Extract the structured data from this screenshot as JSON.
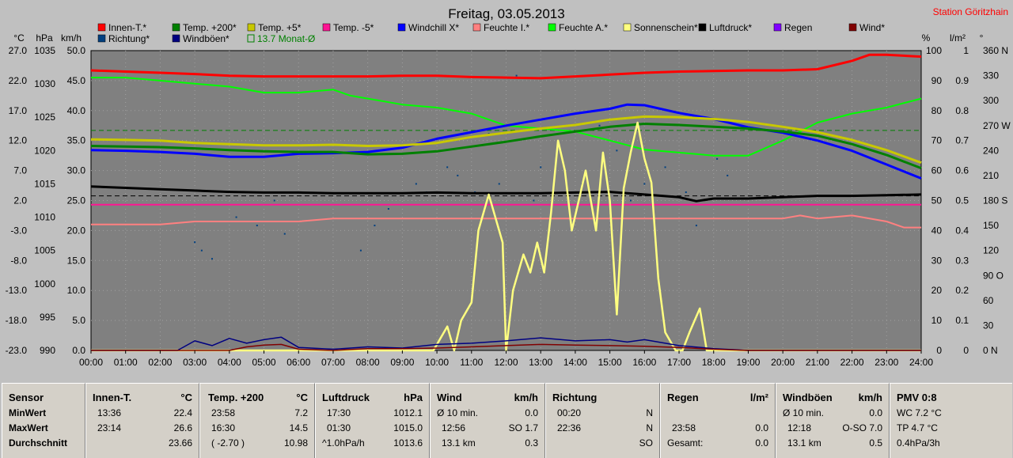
{
  "chart_data": {
    "type": "line",
    "title": "Freitag, 03.05.2013",
    "station": "Station Göritzhain",
    "x_ticks": [
      "00:00",
      "01:00",
      "02:00",
      "03:00",
      "04:00",
      "05:00",
      "06:00",
      "07:00",
      "08:00",
      "09:00",
      "10:00",
      "11:00",
      "12:00",
      "13:00",
      "14:00",
      "15:00",
      "16:00",
      "17:00",
      "18:00",
      "19:00",
      "20:00",
      "21:00",
      "22:00",
      "23:00",
      "24:00"
    ],
    "axis_units_left": [
      "°C",
      "hPa",
      "km/h"
    ],
    "axis_units_right": [
      "%",
      "l/m²",
      "°"
    ],
    "axis_temp": {
      "range": [
        -23,
        27
      ],
      "ticks": [
        "27.0",
        "22.0",
        "17.0",
        "12.0",
        "7.0",
        "2.0",
        "-3.0",
        "-8.0",
        "-13.0",
        "-18.0",
        "-23.0"
      ]
    },
    "axis_pressure": {
      "range": [
        990,
        1035
      ],
      "ticks": [
        "1035",
        "1030",
        "1025",
        "1020",
        "1015",
        "1010",
        "1005",
        "1000",
        "995",
        "990"
      ]
    },
    "axis_wind": {
      "range": [
        0,
        50
      ],
      "ticks": [
        "50.0",
        "45.0",
        "40.0",
        "35.0",
        "30.0",
        "25.0",
        "20.0",
        "15.0",
        "10.0",
        "5.0",
        "0.0"
      ]
    },
    "axis_humidity": {
      "range": [
        0,
        100
      ],
      "ticks": [
        "100",
        "90",
        "80",
        "70",
        "60",
        "50",
        "40",
        "30",
        "20",
        "10",
        "0"
      ]
    },
    "axis_rain": {
      "range": [
        0,
        1
      ],
      "ticks": [
        "1",
        "0.9",
        "0.8",
        "0.7",
        "0.6",
        "0.5",
        "0.4",
        "0.3",
        "0.2",
        "0.1",
        "0"
      ]
    },
    "axis_direction": {
      "range": [
        0,
        360
      ],
      "ticks": [
        "360 N",
        "330",
        "300",
        "270 W",
        "240",
        "210",
        "180 S",
        "150",
        "120",
        "90 O",
        "60",
        "30",
        "0 N"
      ]
    },
    "legend": [
      {
        "label": "Innen-T.*",
        "color": "#ff0000"
      },
      {
        "label": "Temp. +200*",
        "color": "#008000"
      },
      {
        "label": "Temp. +5*",
        "color": "#c8c800"
      },
      {
        "label": "Temp. -5*",
        "color": "#ff1493"
      },
      {
        "label": "Windchill X*",
        "color": "#0000ff"
      },
      {
        "label": "Feuchte I.*",
        "color": "#ff8080"
      },
      {
        "label": "Feuchte A.*",
        "color": "#00ff00"
      },
      {
        "label": "Sonnenschein*",
        "color": "#ffff80"
      },
      {
        "label": "Luftdruck*",
        "color": "#000000"
      },
      {
        "label": "Regen",
        "color": "#8000ff"
      },
      {
        "label": "Wind*",
        "color": "#800000"
      },
      {
        "label": "Richtung*",
        "color": "#004080"
      },
      {
        "label": "Windböen*",
        "color": "#000080"
      },
      {
        "label": "13.7 Monat-Ø",
        "color": "#008000"
      }
    ],
    "series": [
      {
        "name": "Innen-T.*",
        "axis": "temp",
        "color": "#ff0000",
        "width": 3,
        "x": [
          0,
          1,
          2,
          3,
          4,
          5,
          6,
          7,
          8,
          9,
          10,
          11,
          12,
          13,
          14,
          15,
          16,
          17,
          18,
          19,
          20,
          21,
          22,
          22.5,
          23,
          24
        ],
        "y": [
          23.7,
          23.5,
          23.3,
          23.1,
          22.8,
          22.7,
          22.7,
          22.7,
          22.7,
          22.8,
          22.8,
          22.6,
          22.5,
          22.4,
          22.7,
          23.0,
          23.3,
          23.5,
          23.6,
          23.7,
          23.7,
          23.9,
          25.3,
          26.3,
          26.3,
          26.0
        ]
      },
      {
        "name": "Feuchte A.*",
        "axis": "humidity",
        "color": "#00ff00",
        "width": 2,
        "x": [
          0,
          1,
          2,
          3,
          4,
          5,
          6,
          7,
          7.5,
          8,
          9,
          10,
          11,
          12,
          13,
          14,
          15,
          16,
          17,
          18,
          19,
          20,
          21,
          22,
          23,
          24
        ],
        "y": [
          91,
          91,
          90,
          89,
          88,
          86,
          86,
          87,
          85,
          84,
          82,
          81,
          79,
          75,
          74,
          73,
          70,
          67,
          66,
          65,
          65,
          70,
          76,
          79,
          81,
          84
        ]
      },
      {
        "name": "Windchill X*",
        "axis": "temp",
        "color": "#0000ff",
        "width": 3,
        "x": [
          0,
          1,
          2,
          3,
          4,
          5,
          6,
          7,
          8,
          9,
          10,
          11,
          12,
          13,
          14,
          15,
          15.5,
          16,
          17,
          18,
          19,
          20,
          21,
          22,
          23,
          24
        ],
        "y": [
          10.4,
          10.3,
          10.1,
          9.8,
          9.3,
          9.3,
          9.8,
          9.9,
          10.1,
          10.8,
          12.3,
          13.4,
          14.5,
          15.5,
          16.5,
          17.3,
          18.0,
          17.9,
          16.6,
          15.6,
          14.2,
          13.3,
          12.0,
          10.3,
          8.0,
          5.7
        ]
      },
      {
        "name": "Temp. +5*",
        "axis": "temp",
        "color": "#c8c800",
        "width": 3,
        "x": [
          0,
          1,
          2,
          3,
          4,
          5,
          6,
          7,
          8,
          9,
          10,
          11,
          12,
          13,
          14,
          15,
          16,
          17,
          18,
          19,
          20,
          21,
          22,
          23,
          24
        ],
        "y": [
          12.2,
          12.1,
          12.0,
          11.6,
          11.4,
          11.2,
          11.2,
          11.3,
          11.1,
          11.2,
          11.6,
          12.6,
          13.3,
          14.0,
          14.6,
          15.5,
          16.0,
          15.9,
          15.6,
          15.1,
          14.3,
          13.4,
          12.1,
          10.4,
          8.3
        ]
      },
      {
        "name": "Temp. +200*",
        "axis": "temp",
        "color": "#008000",
        "width": 3,
        "x": [
          0,
          1,
          2,
          3,
          4,
          5,
          6,
          7,
          8,
          9,
          10,
          11,
          12,
          13,
          14,
          15,
          16,
          17,
          18,
          19,
          20,
          21,
          22,
          23,
          24
        ],
        "y": [
          11.1,
          11.0,
          10.9,
          10.7,
          10.4,
          10.2,
          10.1,
          10.1,
          9.7,
          9.8,
          10.2,
          11.0,
          11.8,
          12.7,
          13.5,
          14.3,
          14.8,
          14.6,
          14.3,
          14.0,
          13.5,
          12.8,
          11.4,
          9.6,
          7.4
        ]
      },
      {
        "name": "Luftdruck*",
        "axis": "pressure",
        "color": "#000000",
        "width": 3,
        "x": [
          0,
          1,
          2,
          3,
          4,
          5,
          6,
          7,
          8,
          9,
          10,
          11,
          12,
          13,
          14,
          15,
          16,
          17,
          17.5,
          18,
          19,
          20,
          21,
          22,
          23,
          24
        ],
        "y": [
          1014.6,
          1014.4,
          1014.2,
          1014.0,
          1013.8,
          1013.7,
          1013.7,
          1013.6,
          1013.6,
          1013.6,
          1013.7,
          1013.6,
          1013.6,
          1013.6,
          1013.7,
          1013.8,
          1013.4,
          1013.0,
          1012.4,
          1012.8,
          1012.8,
          1013.0,
          1013.2,
          1013.2,
          1013.3,
          1013.4
        ]
      },
      {
        "name": "Feuchte I.*",
        "axis": "humidity",
        "color": "#ff8080",
        "width": 2,
        "x": [
          0,
          1,
          2,
          3,
          4,
          5,
          6,
          7,
          8,
          9,
          10,
          11,
          12,
          13,
          14,
          15,
          16,
          17,
          18,
          19,
          20,
          20.5,
          21,
          22,
          23,
          23.5,
          24
        ],
        "y": [
          42,
          42,
          42,
          43,
          43,
          43,
          43,
          44,
          44,
          44,
          44,
          44,
          44,
          44,
          44,
          44,
          44,
          44,
          44,
          44,
          44,
          45,
          44,
          45,
          43,
          41,
          41
        ]
      },
      {
        "name": "Temp. -5*",
        "axis": "temp",
        "color": "#ff1493",
        "width": 2,
        "x": [
          0,
          24
        ],
        "y": [
          1.3,
          1.3
        ]
      },
      {
        "name": "Sonnenschein*",
        "axis": "wind",
        "color": "#ffff80",
        "width": 2.5,
        "x": [
          0,
          9.6,
          9.9,
          10.3,
          10.5,
          10.7,
          11.0,
          11.2,
          11.5,
          11.9,
          12.0,
          12.2,
          12.5,
          12.7,
          12.9,
          13.1,
          13.3,
          13.5,
          13.7,
          13.9,
          14.1,
          14.3,
          14.6,
          14.8,
          15.0,
          15.2,
          15.4,
          15.6,
          15.8,
          16.0,
          16.2,
          16.4,
          16.6,
          16.9,
          17.1,
          17.3,
          17.6,
          17.8,
          18.0,
          24
        ],
        "y": [
          0,
          0,
          0,
          4,
          0,
          5,
          8,
          20,
          26,
          18,
          0,
          10,
          16,
          13,
          18,
          13,
          23,
          35,
          30,
          20,
          25,
          30,
          20,
          33,
          25,
          6,
          27,
          33,
          38,
          32,
          28,
          12,
          3,
          0,
          0,
          3,
          7,
          0,
          0,
          0
        ]
      },
      {
        "name": "Windböen*",
        "axis": "wind",
        "color": "#000080",
        "width": 1.5,
        "x": [
          0,
          2.5,
          3.0,
          3.5,
          4.0,
          4.5,
          5.0,
          5.5,
          6.0,
          7.0,
          8.0,
          9.0,
          10.0,
          11.0,
          12.0,
          13.0,
          14.0,
          15.0,
          15.5,
          16.0,
          17.0,
          18.0,
          19.0,
          24
        ],
        "y": [
          0,
          0,
          1.6,
          0.8,
          2.0,
          1.2,
          1.8,
          2.2,
          0.5,
          0.2,
          0.6,
          0.4,
          1.0,
          1.2,
          1.6,
          2.1,
          1.6,
          1.8,
          1.4,
          1.8,
          0.8,
          0.3,
          0,
          0
        ]
      },
      {
        "name": "Wind*",
        "axis": "wind",
        "color": "#800000",
        "width": 1.5,
        "x": [
          0,
          4.0,
          4.5,
          5.0,
          5.5,
          6.0,
          7.0,
          8.0,
          9.0,
          10.0,
          11.0,
          12.0,
          13.0,
          14.0,
          15.0,
          16.0,
          17.0,
          18.0,
          19.0,
          24
        ],
        "y": [
          0,
          0,
          0.6,
          0.9,
          1.0,
          0.2,
          0,
          0.3,
          0.3,
          0.4,
          0.6,
          0.8,
          1.0,
          0.9,
          0.8,
          0.7,
          0.5,
          0.2,
          0,
          0
        ]
      },
      {
        "name": "Richtung*",
        "axis": "direction",
        "color": "#004080",
        "type": "scatter",
        "x": [
          3.0,
          3.2,
          3.5,
          4.2,
          4.8,
          5.3,
          5.6,
          7.8,
          8.2,
          8.6,
          9.4,
          9.7,
          10.3,
          10.6,
          11.1,
          11.5,
          11.8,
          12.3,
          12.8,
          13.0,
          13.5,
          14.2,
          14.7,
          15.2,
          15.6,
          16.0,
          16.6,
          17.2,
          17.5,
          18.1,
          18.4
        ],
        "y": [
          130,
          120,
          110,
          160,
          150,
          180,
          140,
          120,
          150,
          170,
          200,
          190,
          220,
          210,
          190,
          260,
          200,
          330,
          180,
          220,
          250,
          200,
          270,
          240,
          180,
          200,
          220,
          190,
          150,
          230,
          210
        ]
      }
    ],
    "reference_lines": [
      {
        "axis": "temp",
        "value": 13.7,
        "label": "13.7 Monat-Ø",
        "color": "#008000"
      },
      {
        "axis": "pressure",
        "value": 1013.2,
        "label": "",
        "color": "#000000"
      }
    ]
  },
  "stats": {
    "sensor": {
      "title": "Sensor",
      "rows": [
        "MinWert",
        "MaxWert",
        "Durchschnitt"
      ]
    },
    "innen": {
      "title": "Innen-T.",
      "unit": "°C",
      "rows": [
        [
          "13:36",
          "22.4"
        ],
        [
          "23:14",
          "26.6"
        ],
        [
          "",
          "23.66"
        ]
      ]
    },
    "temp200": {
      "title": "Temp. +200",
      "unit": "°C",
      "rows": [
        [
          "23:58",
          "7.2"
        ],
        [
          "16:30",
          "14.5"
        ],
        [
          "( -2.70 )",
          "10.98"
        ]
      ]
    },
    "luftdruck": {
      "title": "Luftdruck",
      "unit": "hPa",
      "rows": [
        [
          "17:30",
          "1012.1"
        ],
        [
          "01:30",
          "1015.0"
        ],
        [
          "^1.0hPa/h",
          "1013.6"
        ]
      ]
    },
    "wind": {
      "title": "Wind",
      "unit": "km/h",
      "rows": [
        [
          "Ø 10 min.",
          "",
          "0.0"
        ],
        [
          "12:56",
          "SO 1.7",
          ""
        ],
        [
          "13.1 km",
          "",
          "0.3"
        ]
      ]
    },
    "richtung": {
      "title": "Richtung",
      "unit": "",
      "rows": [
        [
          "00:20",
          "N"
        ],
        [
          "22:36",
          "N"
        ],
        [
          "",
          "SO"
        ]
      ]
    },
    "regen": {
      "title": "Regen",
      "unit": "l/m²",
      "rows": [
        [
          "",
          ""
        ],
        [
          "23:58",
          "0.0"
        ],
        [
          "Gesamt:",
          "0.0"
        ]
      ]
    },
    "windboen": {
      "title": "Windböen",
      "unit": "km/h",
      "rows": [
        [
          "Ø 10 min.",
          "",
          "0.0"
        ],
        [
          "12:18",
          "O-SO 7.0",
          ""
        ],
        [
          "13.1 km",
          "",
          "0.5"
        ]
      ]
    },
    "pmv": {
      "title": "PMV 0:8",
      "rows": [
        "WC 7.2 °C",
        "TP 4.7 °C",
        "0.4hPa/3h"
      ]
    }
  }
}
